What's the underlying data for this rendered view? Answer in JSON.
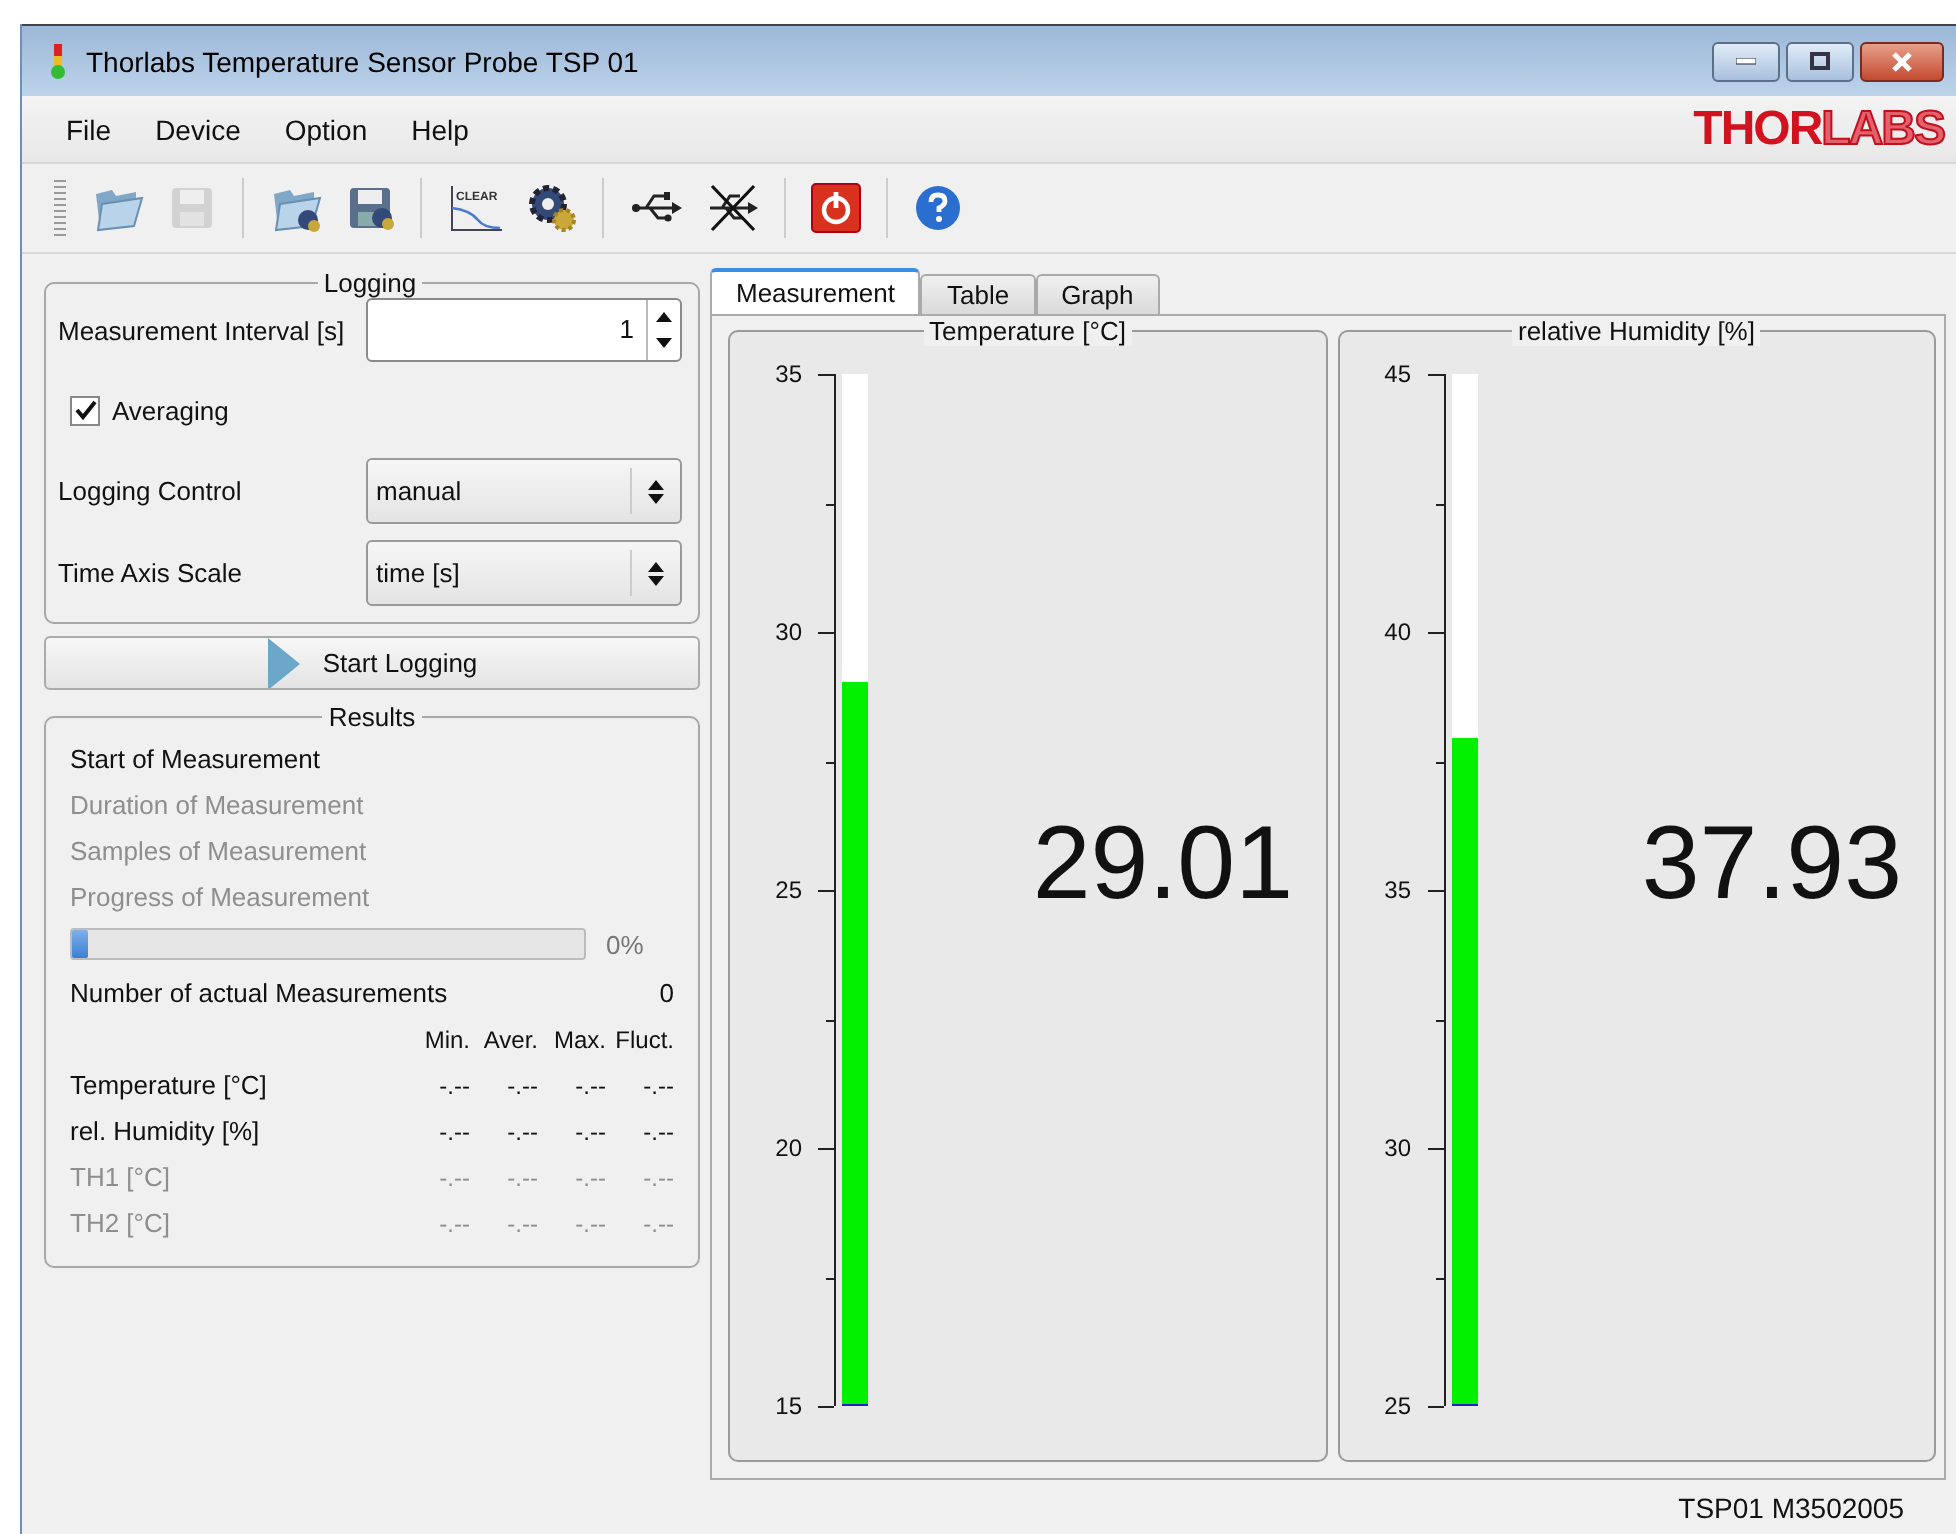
{
  "window": {
    "title": "Thorlabs Temperature Sensor Probe TSP 01"
  },
  "menu": [
    "File",
    "Device",
    "Option",
    "Help"
  ],
  "logo": {
    "bold": "THOR",
    "light": "LABS"
  },
  "toolbar": [
    [
      {
        "kind": "open",
        "disabled": false
      },
      {
        "kind": "save",
        "disabled": true
      }
    ],
    [
      {
        "kind": "open-config",
        "disabled": false
      },
      {
        "kind": "save-config",
        "disabled": false
      }
    ],
    [
      {
        "kind": "clear",
        "label": "CLEAR",
        "disabled": false
      },
      {
        "kind": "settings",
        "disabled": false
      }
    ],
    [
      {
        "kind": "usb",
        "disabled": false
      },
      {
        "kind": "disconnect",
        "disabled": false
      }
    ],
    [
      {
        "kind": "power",
        "disabled": false
      }
    ],
    [
      {
        "kind": "help",
        "disabled": false
      }
    ]
  ],
  "logging": {
    "title": "Logging",
    "interval": {
      "label": "Measurement Interval [s]",
      "value": "1"
    },
    "averaging": {
      "label": "Averaging",
      "checked": true
    },
    "control": {
      "label": "Logging Control",
      "value": "manual"
    },
    "axis": {
      "label": "Time Axis Scale",
      "value": "time [s]"
    }
  },
  "start_button": "Start Logging",
  "results": {
    "title": "Results",
    "lines": [
      {
        "text": "Start of Measurement",
        "disabled": false
      },
      {
        "text": "Duration of Measurement",
        "disabled": true
      },
      {
        "text": "Samples of Measurement",
        "disabled": true
      },
      {
        "text": "Progress of Measurement",
        "disabled": true
      }
    ],
    "progress": {
      "level": 0.03,
      "reading": "0%"
    },
    "count": {
      "label": "Number of actual Measurements",
      "value": "0"
    },
    "columns": [
      "Min.",
      "Aver.",
      "Max.",
      "Fluct."
    ],
    "rows": [
      {
        "label": "Temperature [°C]",
        "values": [
          "-.--",
          "-.--",
          "-.--",
          "-.--"
        ],
        "disabled": false
      },
      {
        "label": "rel. Humidity [%]",
        "values": [
          "-.--",
          "-.--",
          "-.--",
          "-.--"
        ],
        "disabled": false
      },
      {
        "label": "TH1 [°C]",
        "values": [
          "-.--",
          "-.--",
          "-.--",
          "-.--"
        ],
        "disabled": true
      },
      {
        "label": "TH2 [°C]",
        "values": [
          "-.--",
          "-.--",
          "-.--",
          "-.--"
        ],
        "disabled": true
      }
    ]
  },
  "tabs": [
    {
      "label": "Measurement",
      "selected": true
    },
    {
      "label": "Table",
      "selected": false
    },
    {
      "label": "Graph",
      "selected": false
    }
  ],
  "gauges": [
    {
      "title": "Temperature [°C]",
      "ticks": [
        "35",
        "30",
        "25",
        "20",
        "15"
      ],
      "level": 0.7005,
      "reading": "29.01"
    },
    {
      "title": "relative Humidity [%]",
      "ticks": [
        "45",
        "40",
        "35",
        "30",
        "25"
      ],
      "level": 0.6465,
      "reading": "37.93"
    }
  ],
  "status_bar": "TSP01 M3502005"
}
